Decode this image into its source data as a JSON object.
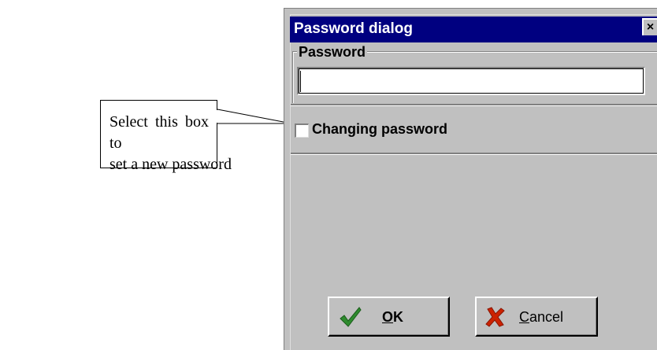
{
  "annotation": {
    "line1": "Select this box to",
    "line2": "set a new password"
  },
  "dialog": {
    "title": "Password dialog",
    "close_glyph": "×",
    "password_group_label": "Password",
    "password_value": "",
    "change_checkbox_label": "Changing password",
    "change_checkbox_checked": false,
    "ok_label": "OK",
    "cancel_label": "Cancel",
    "ok_icon": "green-checkmark-icon",
    "cancel_icon": "red-x-icon"
  },
  "colors": {
    "titlebar": "#000080",
    "face": "#c0c0c0",
    "ok_check": "#2e8b2e",
    "cancel_x": "#cc2200"
  }
}
